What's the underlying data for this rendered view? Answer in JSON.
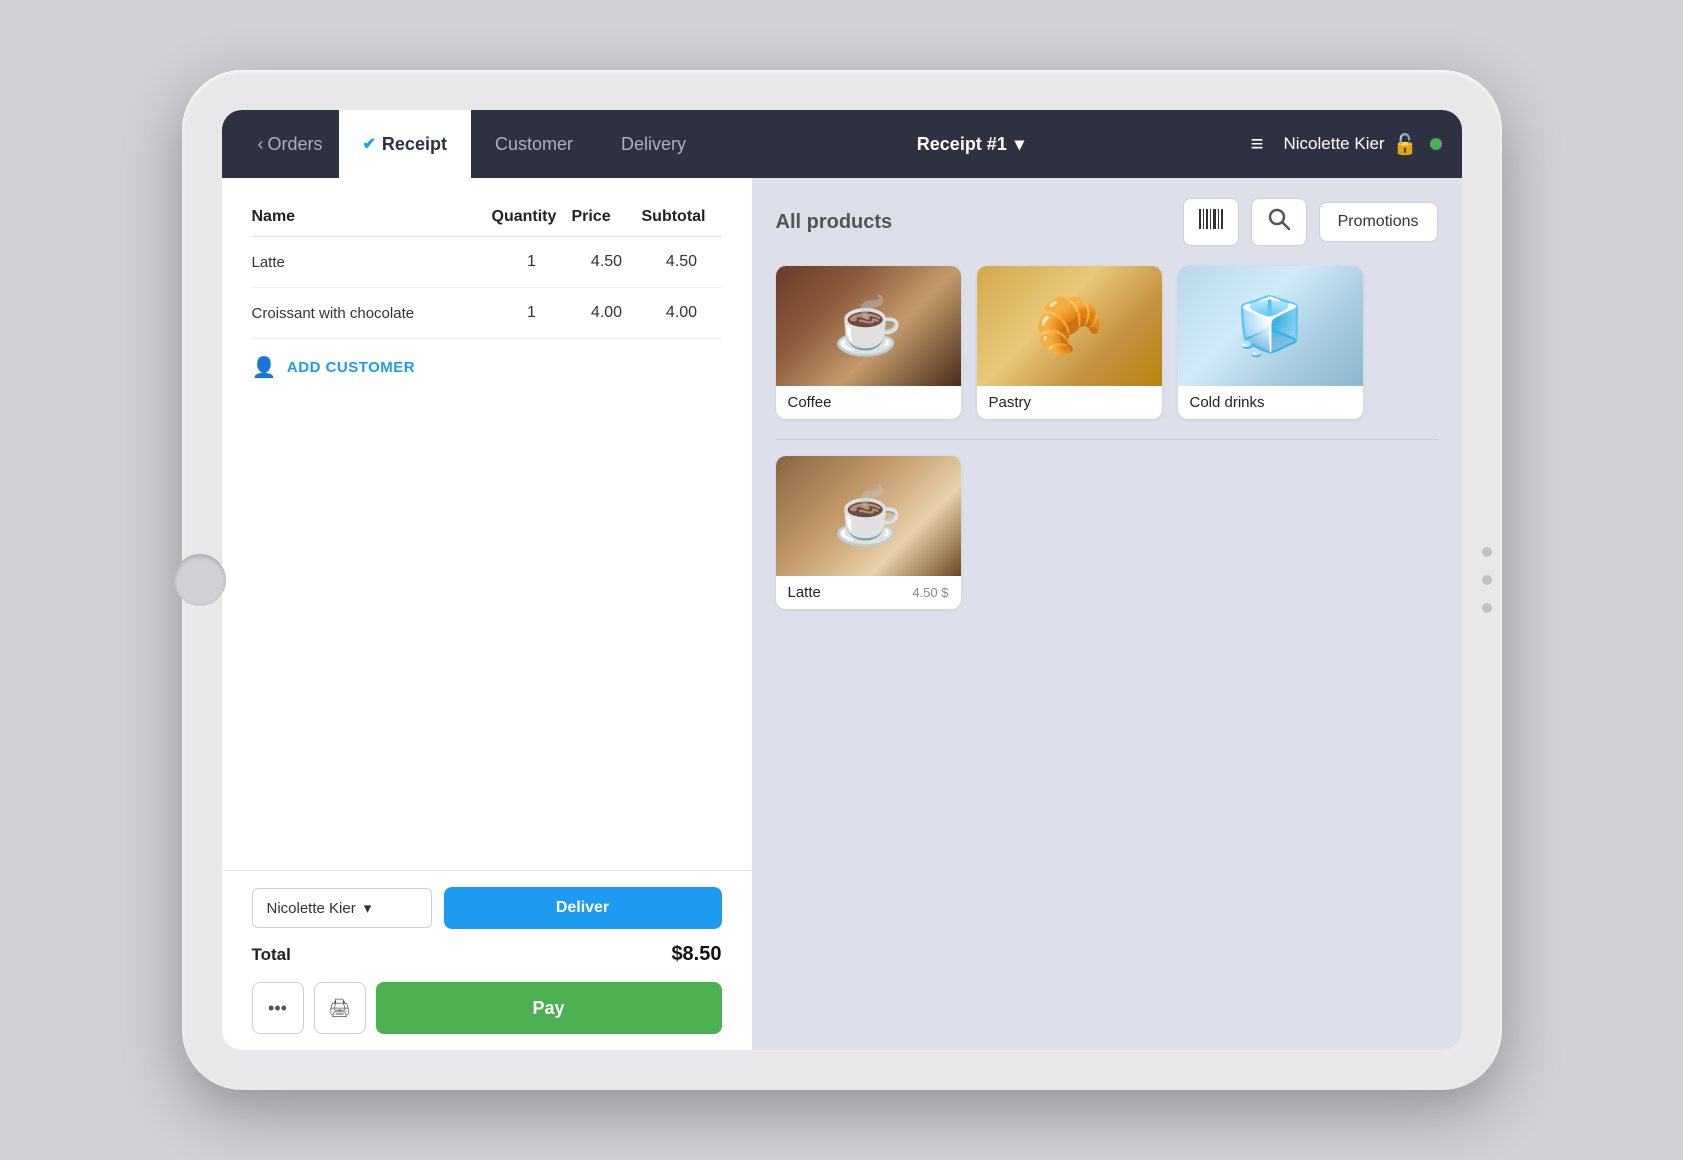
{
  "tablet": {
    "frame_color": "#e8e8ea"
  },
  "topnav": {
    "orders_label": "Orders",
    "receipt_tab_label": "Receipt",
    "customer_tab_label": "Customer",
    "delivery_tab_label": "Delivery",
    "receipt_number": "Receipt #1",
    "hamburger_icon": "≡",
    "user_name": "Nicolette Kier",
    "lock_icon": "🔓",
    "chevron_icon": "▾"
  },
  "receipt": {
    "table_headers": {
      "name": "Name",
      "quantity": "Quantity",
      "price": "Price",
      "subtotal": "Subtotal"
    },
    "items": [
      {
        "name": "Latte",
        "quantity": 1,
        "price": "4.50",
        "subtotal": "4.50"
      },
      {
        "name": "Croissant with chocolate",
        "quantity": 1,
        "price": "4.00",
        "subtotal": "4.00"
      }
    ],
    "add_customer_label": "ADD CUSTOMER",
    "cashier_name": "Nicolette Kier",
    "deliver_btn_label": "Deliver",
    "total_label": "Total",
    "total_amount": "$8.50",
    "dots_icon": "•••",
    "print_icon": "🖨",
    "pay_btn_label": "Pay"
  },
  "products": {
    "section_title": "All products",
    "barcode_icon": "barcode",
    "search_icon": "search",
    "promotions_label": "Promotions",
    "categories": [
      {
        "id": "coffee",
        "name": "Coffee",
        "img_type": "coffee"
      },
      {
        "id": "pastry",
        "name": "Pastry",
        "img_type": "pastry"
      },
      {
        "id": "cold-drinks",
        "name": "Cold drinks",
        "img_type": "cold"
      }
    ],
    "items": [
      {
        "id": "latte",
        "name": "Latte",
        "price": "4.50 $",
        "img_type": "latte"
      }
    ]
  }
}
